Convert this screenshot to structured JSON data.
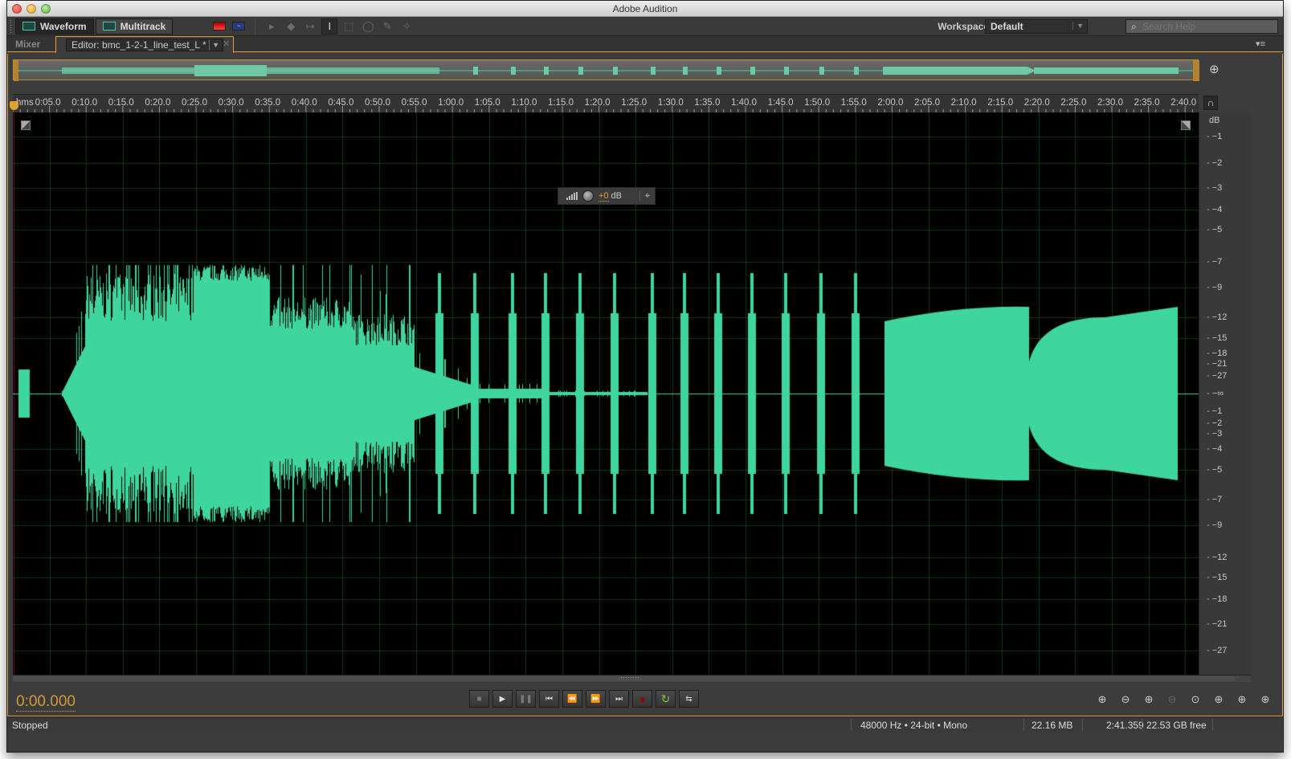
{
  "window": {
    "title": "Adobe Audition"
  },
  "toolbar": {
    "modes": [
      {
        "label": "Waveform",
        "icon": "waveform-view-icon",
        "active": true
      },
      {
        "label": "Multitrack",
        "icon": "multitrack-view-icon",
        "active": false
      }
    ],
    "view_buttons": [
      "spectral-frequency-display-icon",
      "waveform-display-icon"
    ],
    "tools": [
      "move-tool-icon",
      "razor-tool-icon",
      "slip-tool-icon",
      "time-selection-tool-icon",
      "marquee-tool-icon",
      "lasso-tool-icon",
      "brush-tool-icon",
      "spot-healing-tool-icon"
    ],
    "workspace_label": "Workspace:",
    "workspace_value": "Default",
    "search_placeholder": "Search Help"
  },
  "tabs": {
    "mixer": "Mixer",
    "editor": "Editor: bmc_1-2-1_line_test_L *"
  },
  "timeline": {
    "unit": "hms",
    "ticks": [
      "0:05.0",
      "0:10.0",
      "0:15.0",
      "0:20.0",
      "0:25.0",
      "0:30.0",
      "0:35.0",
      "0:40.0",
      "0:45.0",
      "0:50.0",
      "0:55.0",
      "1:00.0",
      "1:05.0",
      "1:10.0",
      "1:15.0",
      "1:20.0",
      "1:25.0",
      "1:30.0",
      "1:35.0",
      "1:40.0",
      "1:45.0",
      "1:50.0",
      "1:55.0",
      "2:00.0",
      "2:05.0",
      "2:10.0",
      "2:15.0",
      "2:20.0",
      "2:25.0",
      "2:30.0",
      "2:35.0",
      "2:40.0"
    ],
    "total_seconds": 161.359
  },
  "amplitude_scale": {
    "unit": "dB",
    "upper": [
      "-1",
      "-2",
      "-3",
      "-4",
      "-5",
      "-7",
      "-9",
      "-12",
      "-15",
      "-18",
      "-21",
      "-27"
    ],
    "center": "-∞",
    "lower": [
      "-27",
      "-21",
      "-18",
      "-15",
      "-12",
      "-9",
      "-7",
      "-5",
      "-4",
      "-3",
      "-2",
      "-1"
    ]
  },
  "hud": {
    "gain_value": "+0",
    "gain_unit": "dB"
  },
  "transport": {
    "timecode": "0:00.000",
    "buttons": [
      {
        "name": "stop",
        "glyph": "■",
        "enabled": false
      },
      {
        "name": "play",
        "glyph": "▶",
        "enabled": true
      },
      {
        "name": "pause",
        "glyph": "❚❚",
        "enabled": false
      },
      {
        "name": "skip-to-start",
        "glyph": "⏮",
        "enabled": true
      },
      {
        "name": "rewind",
        "glyph": "⏪",
        "enabled": true
      },
      {
        "name": "fast-forward",
        "glyph": "⏩",
        "enabled": true
      },
      {
        "name": "skip-to-end",
        "glyph": "⏭",
        "enabled": true
      },
      {
        "name": "record",
        "glyph": "●",
        "enabled": true
      },
      {
        "name": "loop-playback",
        "glyph": "↻",
        "enabled": true
      },
      {
        "name": "skip-selection",
        "glyph": "⇆",
        "enabled": true
      }
    ],
    "colors": {
      "record": "#8b0a14",
      "loop": "#7ac943",
      "timecode": "#d29a3a"
    }
  },
  "zoom_controls": [
    {
      "name": "zoom-in-amplitude",
      "glyph": "⊕",
      "enabled": true
    },
    {
      "name": "zoom-out-amplitude",
      "glyph": "⊖",
      "enabled": true
    },
    {
      "name": "zoom-in-time",
      "glyph": "⊕",
      "enabled": true
    },
    {
      "name": "zoom-out-time",
      "glyph": "⊖",
      "enabled": false
    },
    {
      "name": "zoom-out-full",
      "glyph": "⊙",
      "enabled": true
    },
    {
      "name": "zoom-in-at-in-point",
      "glyph": "⊕",
      "enabled": true
    },
    {
      "name": "zoom-in-at-out-point",
      "glyph": "⊕",
      "enabled": true
    },
    {
      "name": "zoom-to-selection",
      "glyph": "⊕",
      "enabled": true
    }
  ],
  "status": {
    "state": "Stopped",
    "format": "48000 Hz • 24-bit • Mono",
    "size": "22.16 MB",
    "duration": "2:41.359",
    "free": "22.53 GB free"
  },
  "colors": {
    "waveform": "#3ed69e",
    "accent": "#e2a233",
    "background": "#000000",
    "grid": "#0e3a14"
  }
}
